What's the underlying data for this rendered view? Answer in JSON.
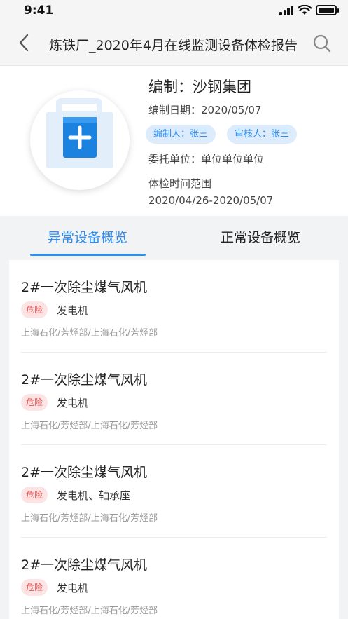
{
  "status_bar": {
    "time": "9:41"
  },
  "nav": {
    "title": "炼铁厂_2020年4月在线监测设备体检报告"
  },
  "header": {
    "org": "编制：沙钢集团",
    "date": "编制日期：2020/05/07",
    "editor_tag": "编制人：张三",
    "reviewer_tag": "审核人：张三",
    "entrust": "委托单位：单位单位单位",
    "range_label": "体检时间范围",
    "range_value": "2020/04/26-2020/05/07"
  },
  "tabs": [
    {
      "label": "异常设备概览",
      "active": true
    },
    {
      "label": "正常设备概览",
      "active": false
    }
  ],
  "colors": {
    "accent": "#2f8ef0",
    "danger": "#e65454",
    "danger_bg": "#fde4e4",
    "tag_bg": "#dcecfd"
  },
  "items": [
    {
      "title": "2#一次除尘煤气风机",
      "badge": "危险",
      "parts": "发电机",
      "path": "上海石化/芳烃部/上海石化/芳烃部"
    },
    {
      "title": "2#一次除尘煤气风机",
      "badge": "危险",
      "parts": "发电机",
      "path": "上海石化/芳烃部/上海石化/芳烃部"
    },
    {
      "title": "2#一次除尘煤气风机",
      "badge": "危险",
      "parts": "发电机、轴承座",
      "path": "上海石化/芳烃部/上海石化/芳烃部"
    },
    {
      "title": "2#一次除尘煤气风机",
      "badge": "危险",
      "parts": "发电机",
      "path": "上海石化/芳烃部/上海石化/芳烃部"
    }
  ]
}
